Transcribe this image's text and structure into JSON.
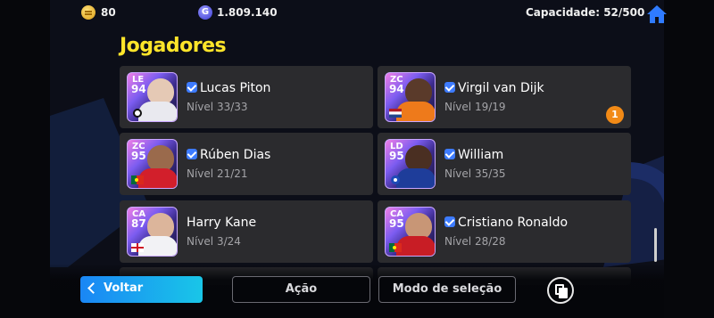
{
  "topbar": {
    "coins": "80",
    "gp": "1.809.140",
    "gp_symbol": "G",
    "capacity": "Capacidade: 52/500",
    "coin_icon": "gold-coin-icon",
    "gp_icon": "gp-coin-icon",
    "home_icon": "home-icon"
  },
  "section_title": "Jogadores",
  "players": [
    {
      "position": "LE",
      "rating": "94",
      "name": "Lucas Piton",
      "verified": true,
      "level": "Nível 33/33",
      "flag": "club-crest",
      "badge": ""
    },
    {
      "position": "ZC",
      "rating": "94",
      "name": "Virgil van Dijk",
      "verified": true,
      "level": "Nível 19/19",
      "flag": "netherlands",
      "badge": "1"
    },
    {
      "position": "ZC",
      "rating": "95",
      "name": "Rúben Dias",
      "verified": true,
      "level": "Nível 21/21",
      "flag": "portugal",
      "badge": ""
    },
    {
      "position": "LD",
      "rating": "95",
      "name": "William",
      "verified": true,
      "level": "Nível 35/35",
      "flag": "club-crest",
      "badge": ""
    },
    {
      "position": "CA",
      "rating": "87",
      "name": "Harry Kane",
      "verified": false,
      "level": "Nível 3/24",
      "flag": "england",
      "badge": ""
    },
    {
      "position": "CA",
      "rating": "95",
      "name": "Cristiano Ronaldo",
      "verified": true,
      "level": "Nível 28/28",
      "flag": "portugal",
      "badge": ""
    }
  ],
  "buttons": {
    "back": "Voltar",
    "action": "Ação",
    "select_mode": "Modo de seleção",
    "copy_icon": "copy-icon"
  },
  "colors": {
    "title": "#ffe52a",
    "card_bg": "#2b2b2e",
    "verified": "#3d7bff",
    "badge": "#f28a16",
    "back_button": "#1a86f5"
  }
}
